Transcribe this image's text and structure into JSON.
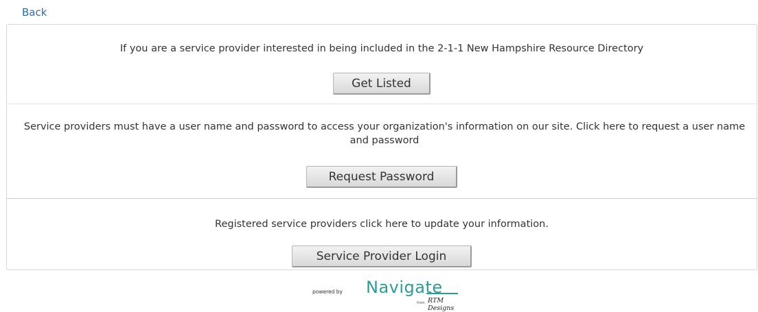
{
  "nav": {
    "back_label": "Back"
  },
  "sections": [
    {
      "text": "If you are a service provider interested in being included in the 2-1-1 New Hampshire Resource Directory",
      "button_label": "Get Listed"
    },
    {
      "text": "Service providers must have a user name and password to access your organization's information on our site. Click here to request a user name and password",
      "button_label": "Request Password"
    },
    {
      "text": "Registered service providers click here to update your information.",
      "button_label": "Service Provider Login"
    }
  ],
  "footer": {
    "powered_by": "powered by",
    "brand": "Navigate",
    "from": "from",
    "company": "RTM Designs",
    "brand_color": "#2a9d96"
  },
  "colors": {
    "link": "#2a6db0",
    "text": "#333333"
  }
}
